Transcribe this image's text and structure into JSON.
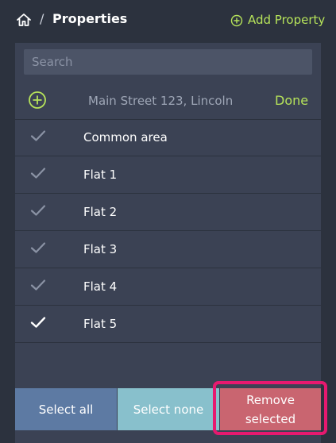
{
  "header": {
    "separator": "/",
    "title": "Properties",
    "add_label": "Add Property"
  },
  "search": {
    "placeholder": "Search"
  },
  "property": {
    "address": "Main Street 123, Lincoln",
    "done_label": "Done"
  },
  "items": [
    {
      "label": "Common area",
      "checked": false
    },
    {
      "label": "Flat 1",
      "checked": false
    },
    {
      "label": "Flat 2",
      "checked": false
    },
    {
      "label": "Flat 3",
      "checked": false
    },
    {
      "label": "Flat 4",
      "checked": false
    },
    {
      "label": "Flat 5",
      "checked": true
    }
  ],
  "buttons": {
    "select_all": "Select all",
    "select_none": "Select none",
    "remove_selected": "Remove selected"
  },
  "colors": {
    "accent": "#b6e35a",
    "panel": "#3b4254",
    "background": "#2c323e",
    "select_all": "#5d7aa3",
    "select_none": "#88c0cc",
    "remove": "#c96570",
    "highlight": "#e6196f"
  },
  "icons": {
    "home": "home-icon",
    "add": "plus-circle-icon",
    "check": "check-icon"
  }
}
